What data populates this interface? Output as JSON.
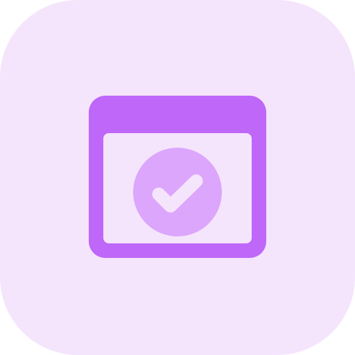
{
  "icon": {
    "name": "browser-window-check-icon",
    "colors": {
      "background": "#F5E5FC",
      "frame": "#BE67F9",
      "circle": "#DCA6FC",
      "check": "#F5E5FC",
      "window_interior": "#F5E5FC"
    }
  }
}
